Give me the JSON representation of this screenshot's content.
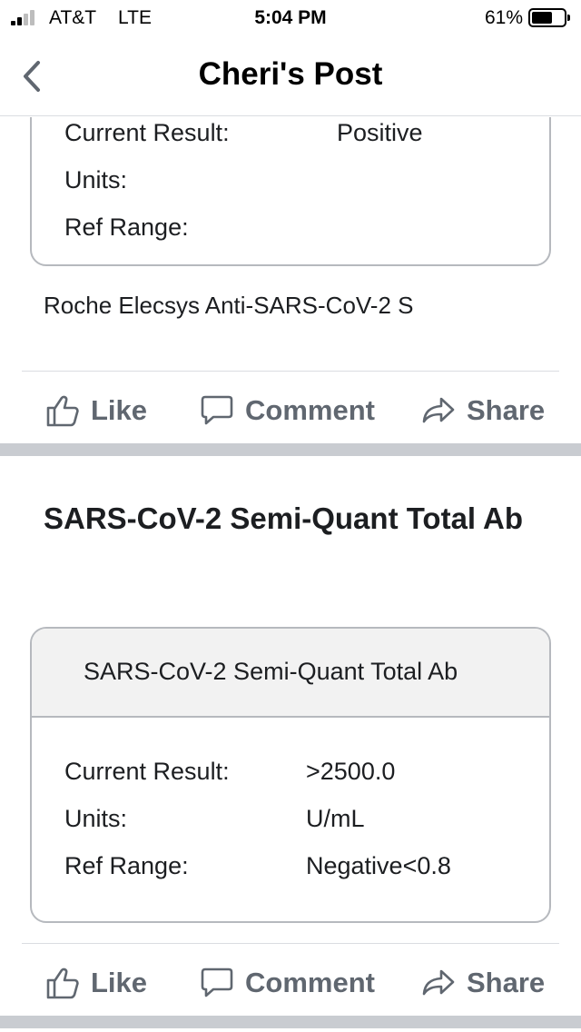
{
  "status_bar": {
    "carrier": "AT&T",
    "network": "LTE",
    "time": "5:04 PM",
    "battery": "61%",
    "battery_level": 0.61
  },
  "header": {
    "title": "Cheri's Post"
  },
  "top_card": {
    "rows": [
      {
        "label": "Current Result:",
        "value": "Positive"
      },
      {
        "label": "Units:",
        "value": ""
      },
      {
        "label": "Ref Range:",
        "value": ""
      }
    ],
    "caption": "Roche Elecsys Anti-SARS-CoV-2 S"
  },
  "actions": {
    "like": "Like",
    "comment": "Comment",
    "share": "Share"
  },
  "second_post": {
    "title": "SARS-CoV-2 Semi-Quant Total Ab",
    "card_header": "SARS-CoV-2 Semi-Quant Total Ab",
    "rows": [
      {
        "label": "Current Result:",
        "value": ">2500.0"
      },
      {
        "label": "Units:",
        "value": "U/mL"
      },
      {
        "label": "Ref Range:",
        "value": "Negative<0.8"
      }
    ]
  }
}
